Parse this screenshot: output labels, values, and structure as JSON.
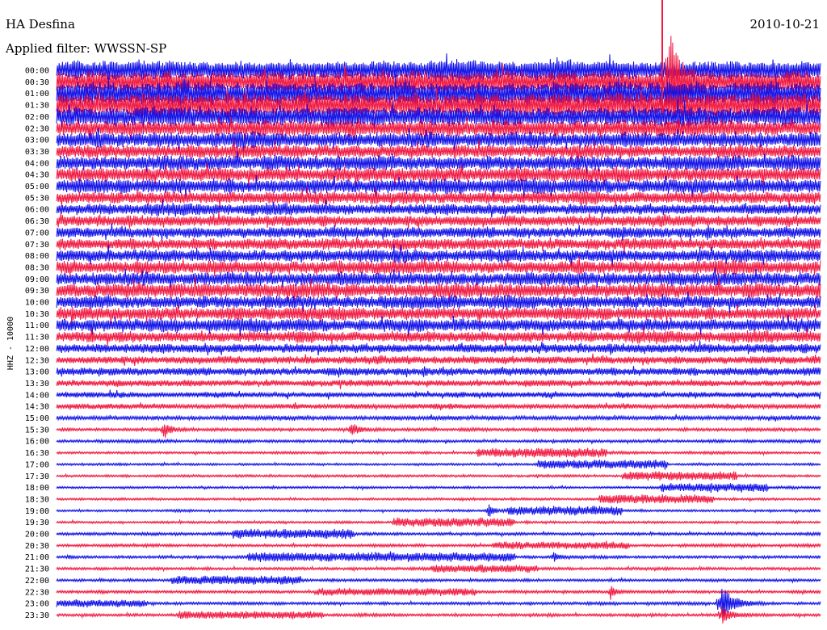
{
  "header": {
    "station": "HA Desfina",
    "date": "2010-10-21",
    "filter": "Applied filter: WWSSN-SP"
  },
  "chart_data": {
    "type": "line",
    "title": "HA Desfina",
    "ylabel": "HHZ - 10000",
    "row_labels": [
      "00:00",
      "00:30",
      "01:00",
      "01:30",
      "02:00",
      "02:30",
      "03:00",
      "03:30",
      "04:00",
      "04:30",
      "05:00",
      "05:30",
      "06:00",
      "06:30",
      "07:00",
      "07:30",
      "08:00",
      "08:30",
      "09:00",
      "09:30",
      "10:00",
      "10:30",
      "11:00",
      "11:30",
      "12:00",
      "12:30",
      "13:00",
      "13:30",
      "14:00",
      "14:30",
      "15:00",
      "15:30",
      "16:00",
      "16:30",
      "17:00",
      "17:30",
      "18:00",
      "18:30",
      "19:00",
      "19:30",
      "20:00",
      "20:30",
      "21:00",
      "21:30",
      "22:00",
      "22:30",
      "23:00",
      "23:30"
    ],
    "colors": {
      "even_rows": "#1010e8",
      "odd_rows": "#f01840"
    },
    "noise_level": [
      12,
      14,
      15,
      15,
      12,
      10,
      9,
      8,
      9,
      9,
      9,
      8,
      7,
      7,
      7,
      7,
      8,
      8,
      8,
      9,
      8,
      8,
      8,
      7,
      6,
      5,
      5,
      4,
      3.5,
      3,
      2.5,
      2,
      1.8,
      1.6,
      1.5,
      1.5,
      1.5,
      1.5,
      1.5,
      1.5,
      1.8,
      1.8,
      1.8,
      1.8,
      1.8,
      1.8,
      1.8,
      1.8
    ],
    "events": [
      {
        "row": 1,
        "t": 0.8,
        "amp": 80,
        "dur": 0.015
      },
      {
        "row": 31,
        "t": 0.14,
        "amp": 10,
        "dur": 0.01
      },
      {
        "row": 31,
        "t": 0.385,
        "amp": 10,
        "dur": 0.01
      },
      {
        "row": 38,
        "t": 0.565,
        "amp": 9,
        "dur": 0.01
      },
      {
        "row": 42,
        "t": 0.65,
        "amp": 6,
        "dur": 0.008
      },
      {
        "row": 45,
        "t": 0.725,
        "amp": 9,
        "dur": 0.01
      },
      {
        "row": 46,
        "t": 0.87,
        "amp": 22,
        "dur": 0.02
      },
      {
        "row": 47,
        "t": 0.87,
        "amp": 12,
        "dur": 0.015
      }
    ],
    "bursts": [
      {
        "row": 33,
        "t0": 0.55,
        "t1": 0.72,
        "amp": 4
      },
      {
        "row": 34,
        "t0": 0.63,
        "t1": 0.8,
        "amp": 4
      },
      {
        "row": 35,
        "t0": 0.74,
        "t1": 0.89,
        "amp": 4
      },
      {
        "row": 36,
        "t0": 0.79,
        "t1": 0.93,
        "amp": 4
      },
      {
        "row": 37,
        "t0": 0.71,
        "t1": 0.86,
        "amp": 4
      },
      {
        "row": 38,
        "t0": 0.59,
        "t1": 0.74,
        "amp": 4
      },
      {
        "row": 39,
        "t0": 0.44,
        "t1": 0.6,
        "amp": 4
      },
      {
        "row": 40,
        "t0": 0.23,
        "t1": 0.39,
        "amp": 4
      },
      {
        "row": 41,
        "t0": 0.57,
        "t1": 0.75,
        "amp": 3
      },
      {
        "row": 42,
        "t0": 0.25,
        "t1": 0.6,
        "amp": 4
      },
      {
        "row": 43,
        "t0": 0.49,
        "t1": 0.63,
        "amp": 3
      },
      {
        "row": 44,
        "t0": 0.15,
        "t1": 0.32,
        "amp": 4
      },
      {
        "row": 45,
        "t0": 0.34,
        "t1": 0.55,
        "amp": 3
      },
      {
        "row": 46,
        "t0": 0.0,
        "t1": 0.12,
        "amp": 3
      },
      {
        "row": 47,
        "t0": 0.16,
        "t1": 0.35,
        "amp": 3
      }
    ]
  }
}
